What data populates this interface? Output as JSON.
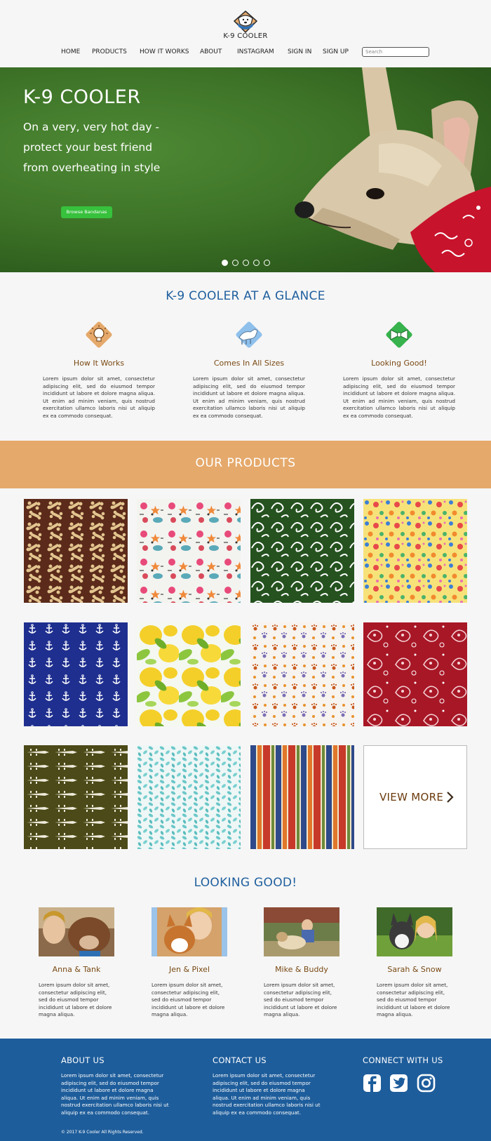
{
  "brand": {
    "name": "K-9 COOLER"
  },
  "nav": {
    "items": [
      "HOME",
      "PRODUCTS",
      "HOW IT WORKS",
      "ABOUT",
      "INSTAGRAM",
      "SIGN IN",
      "SIGN UP"
    ],
    "search_placeholder": "Search"
  },
  "hero": {
    "title": "K-9 COOLER",
    "subtitle": "On a very, very hot day - protect your best friend from overheating in style",
    "button": "Browse Bandanas",
    "slides": 5,
    "active_slide": 1
  },
  "glance": {
    "title": "K-9 COOLER AT A GLANCE",
    "features": [
      {
        "icon": "lightbulb-icon",
        "title": "How It Works",
        "text": "Lorem ipsum dolor sit amet, consectetur adipiscing elit, sed do eiusmod tempor incididunt ut labore et dolore magna aliqua. Ut enim ad minim veniam, quis nostrud exercitation ullamco laboris nisi ut aliquip ex ea commodo consequat."
      },
      {
        "icon": "dog-size-icon",
        "title": "Comes In All Sizes",
        "text": "Lorem ipsum dolor sit amet, consectetur adipiscing elit, sed do eiusmod tempor incididunt ut labore et dolore magna aliqua. Ut enim ad minim veniam, quis nostrud exercitation ullamco laboris nisi ut aliquip ex ea commodo consequat."
      },
      {
        "icon": "bowtie-icon",
        "title": "Looking Good!",
        "text": "Lorem ipsum dolor sit amet, consectetur adipiscing elit, sed do eiusmod tempor incididunt ut labore et dolore magna aliqua. Ut enim ad minim veniam, quis nostrud exercitation ullamco laboris nisi ut aliquip ex ea commodo consequat."
      }
    ],
    "colors": {
      "orange": "#e5a96b",
      "blue": "#8fc0ec",
      "green": "#37b24d"
    }
  },
  "products": {
    "title": "OUR PRODUCTS",
    "patterns": [
      "bones",
      "ocean-critters",
      "green-swirls",
      "polka-dots",
      "anchors",
      "lemons",
      "paw-prints",
      "red-paisley",
      "alligators",
      "teal-leaves",
      "stripes"
    ],
    "view_more": "VIEW MORE"
  },
  "looking_good": {
    "title": "LOOKING GOOD!",
    "pairs": [
      {
        "name": "Anna & Tank",
        "text": "Lorem ipsum dolor sit amet, consectetur adipiscing elit, sed do eiusmod tempor incididunt ut labore et dolore magna aliqua."
      },
      {
        "name": "Jen & Pixel",
        "text": "Lorem ipsum dolor sit amet, consectetur adipiscing elit, sed do eiusmod tempor incididunt ut labore et dolore magna aliqua."
      },
      {
        "name": "Mike & Buddy",
        "text": "Lorem ipsum dolor sit amet, consectetur adipiscing elit, sed do eiusmod tempor incididunt ut labore et dolore magna aliqua."
      },
      {
        "name": "Sarah & Snow",
        "text": "Lorem ipsum dolor sit amet, consectetur adipiscing elit, sed do eiusmod tempor incididunt ut labore et dolore magna aliqua."
      }
    ]
  },
  "footer": {
    "about_title": "ABOUT US",
    "about_text": "Lorem ipsum dolor sit amet, consectetur adipiscing elit, sed do eiusmod tempor incididunt ut labore et dolore magna aliqua. Ut enim ad minim veniam, quis nostrud exercitation ullamco laboris nisi ut aliquip ex ea commodo consequat.",
    "contact_title": "CONTACT US",
    "contact_text": "Lorem ipsum dolor sit amet, consectetur adipiscing elit, sed do eiusmod tempor incididunt ut labore et dolore magna aliqua. Ut enim ad minim veniam, quis nostrud exercitation ullamco laboris nisi ut aliquip ex ea commodo consequat.",
    "connect_title": "CONNECT WITH US",
    "social": [
      "facebook-icon",
      "twitter-icon",
      "instagram-icon"
    ],
    "copyright": "© 2017 K-9 Cooler All Rights Reserved."
  }
}
